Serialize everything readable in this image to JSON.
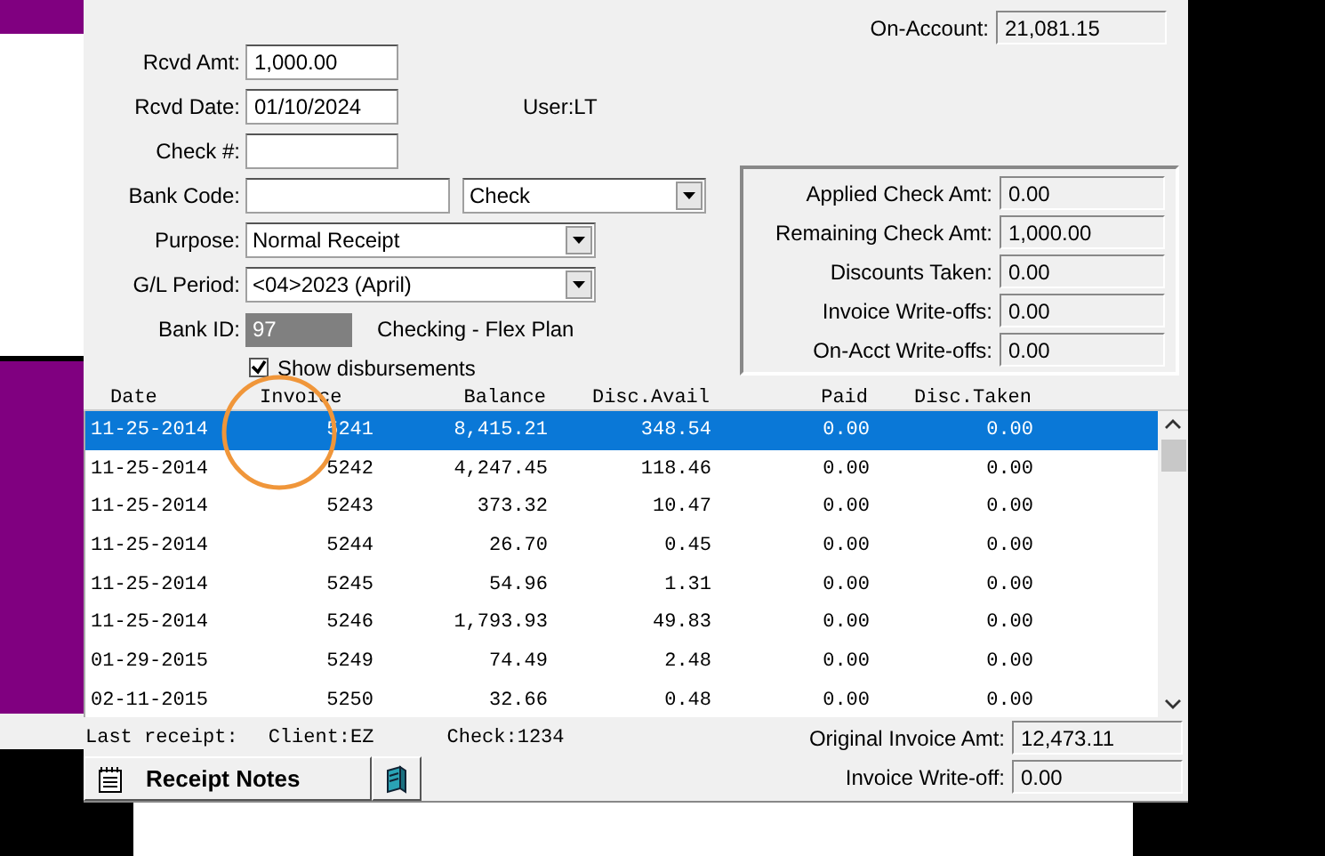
{
  "on_account": {
    "label": "On-Account:",
    "value": "21,081.15"
  },
  "form": [
    {
      "kind": "input",
      "label": "Rcvd Amt:",
      "value": "1,000.00"
    },
    {
      "kind": "input",
      "label": "Rcvd Date:",
      "value": "01/10/2024",
      "note": "User:LT"
    },
    {
      "kind": "input",
      "label": "Check #:"
    },
    {
      "kind": "input_select",
      "label": "Bank Code:",
      "option": "Check"
    },
    {
      "kind": "select",
      "label": "Purpose:",
      "value": "Normal Receipt"
    },
    {
      "kind": "select",
      "label": "G/L Period:",
      "value": "<04>2023 (April)"
    },
    {
      "kind": "readonly",
      "label": "Bank ID:",
      "value": "97",
      "note": "Checking - Flex Plan"
    }
  ],
  "show_disbursements": {
    "label": "Show disbursements",
    "checked": true
  },
  "summary": [
    {
      "label": "Applied Check Amt:",
      "value": "0.00"
    },
    {
      "label": "Remaining Check Amt:",
      "value": "1,000.00"
    },
    {
      "label": "Discounts Taken:",
      "value": "0.00"
    },
    {
      "label": "Invoice Write-offs:",
      "value": "0.00"
    },
    {
      "label": "On-Acct Write-offs:",
      "value": "0.00"
    }
  ],
  "table": {
    "columns": [
      "Date",
      "Invoice",
      "Balance",
      "Disc.Avail",
      "Paid",
      "Disc.Taken"
    ],
    "rows": [
      {
        "cells": [
          "11-25-2014",
          "5241",
          "8,415.21",
          "348.54",
          "0.00",
          "0.00"
        ],
        "selected": true
      },
      {
        "cells": [
          "11-25-2014",
          "5242",
          "4,247.45",
          "118.46",
          "0.00",
          "0.00"
        ],
        "selected": false
      },
      {
        "cells": [
          "11-25-2014",
          "5243",
          "373.32",
          "10.47",
          "0.00",
          "0.00"
        ],
        "selected": false
      },
      {
        "cells": [
          "11-25-2014",
          "5244",
          "26.70",
          "0.45",
          "0.00",
          "0.00"
        ],
        "selected": false
      },
      {
        "cells": [
          "11-25-2014",
          "5245",
          "54.96",
          "1.31",
          "0.00",
          "0.00"
        ],
        "selected": false
      },
      {
        "cells": [
          "11-25-2014",
          "5246",
          "1,793.93",
          "49.83",
          "0.00",
          "0.00"
        ],
        "selected": false
      },
      {
        "cells": [
          "01-29-2015",
          "5249",
          "74.49",
          "2.48",
          "0.00",
          "0.00"
        ],
        "selected": false
      },
      {
        "cells": [
          "02-11-2015",
          "5250",
          "32.66",
          "0.48",
          "0.00",
          "0.00"
        ],
        "selected": false
      }
    ]
  },
  "last_receipt": {
    "label": "Last receipt:",
    "client": "Client:EZ",
    "check": "Check:1234"
  },
  "footer_fields": [
    {
      "label": "Original Invoice Amt:",
      "value": "12,473.11"
    },
    {
      "label": "Invoice Write-off:",
      "value": "0.00"
    }
  ],
  "receipt_notes_button": "Receipt Notes"
}
